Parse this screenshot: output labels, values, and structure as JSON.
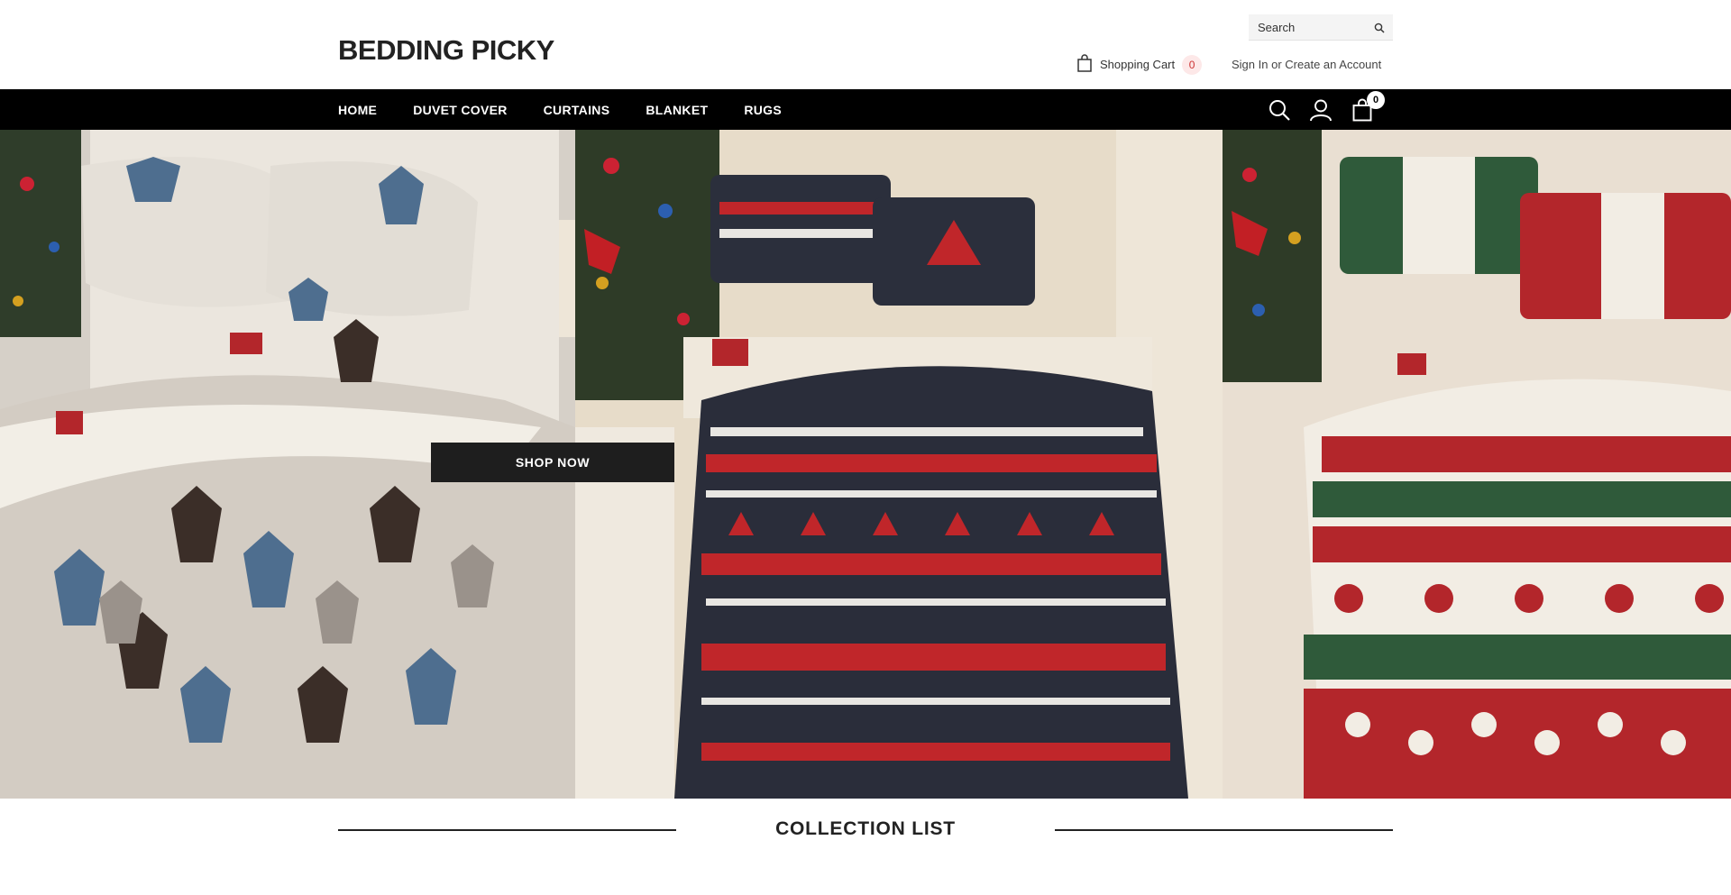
{
  "header": {
    "logo_text": "BEDDING PICKY",
    "search": {
      "placeholder": "Search",
      "icon": "search-icon"
    },
    "cart": {
      "label": "Shopping Cart",
      "count": "0",
      "icon": "shopping-bag-icon"
    },
    "account": {
      "sign_in": "Sign In",
      "separator": "or",
      "create": "Create an Account"
    }
  },
  "nav": {
    "items": [
      {
        "label": "HOME"
      },
      {
        "label": "DUVET COVER"
      },
      {
        "label": "CURTAINS"
      },
      {
        "label": "BLANKET"
      },
      {
        "label": "RUGS"
      }
    ],
    "icons": {
      "search": "search-icon",
      "account": "user-icon",
      "cart": "shopping-bag-icon"
    },
    "cart_badge": "0"
  },
  "hero": {
    "cta_label": "SHOP NOW",
    "panels": [
      {
        "theme": "deer-plaid",
        "colors": [
          "#d8d2ca",
          "#4e6e8f",
          "#3b2e28",
          "#9a928b"
        ]
      },
      {
        "theme": "nordic-knit",
        "colors": [
          "#2a2d3a",
          "#c0262a",
          "#e8e6e2"
        ]
      },
      {
        "theme": "christmas-stripes",
        "colors": [
          "#b3262b",
          "#2f5a3a",
          "#f2ede4"
        ]
      }
    ]
  },
  "collection": {
    "title": "COLLECTION LIST"
  },
  "colors": {
    "nav_bg": "#000000",
    "cta_bg": "#1e1e1e",
    "accent_badge": "#fde8e8"
  }
}
